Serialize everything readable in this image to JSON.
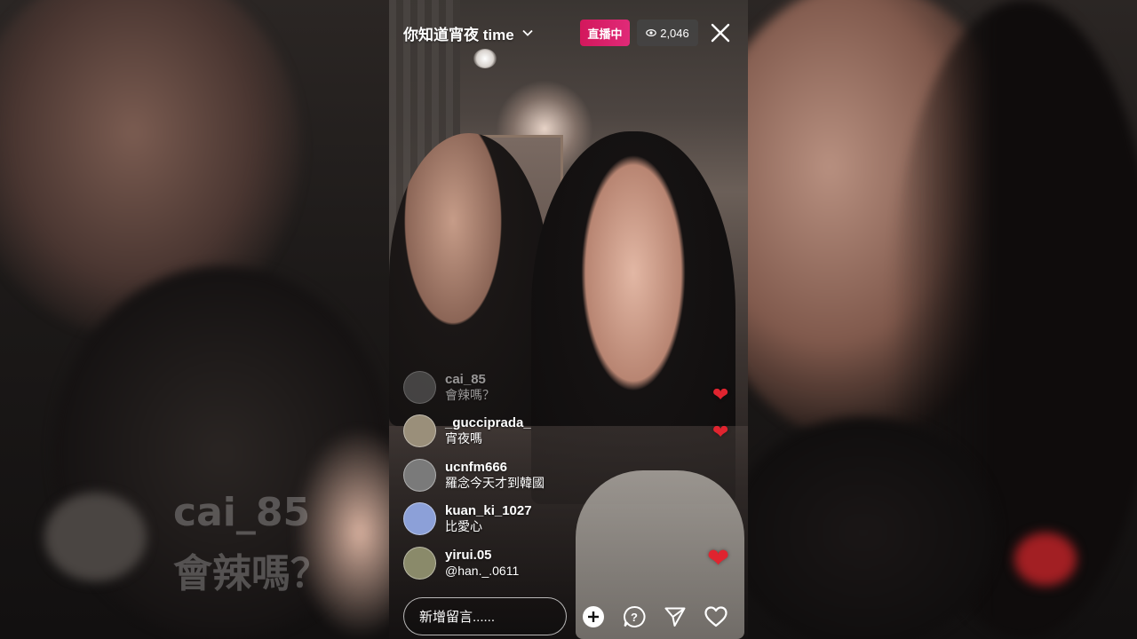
{
  "stream": {
    "title": "你知道宵夜 time",
    "live_label": "直播中",
    "viewer_count": "2,046"
  },
  "comments": [
    {
      "username": "cai_85",
      "message": "會辣嗎？",
      "avatar_color": "#6b6b6b"
    },
    {
      "username": "_gucciprada_",
      "message": "宵夜嗎",
      "avatar_color": "#9a8f7a"
    },
    {
      "username": "ucnfm666",
      "message": "羅念今天才到韓國",
      "avatar_color": "#7a7a7a"
    },
    {
      "username": "kuan_ki_1027",
      "message": "比愛心",
      "avatar_color": "#8ca0d8"
    },
    {
      "username": "yirui.05",
      "message": "@han._.0611",
      "avatar_color": "#8a8a6a"
    }
  ],
  "input": {
    "placeholder": "新增留言......"
  },
  "background_ghost": {
    "username": "cai_85",
    "message": "會辣嗎？"
  },
  "colors": {
    "live_badge": "#d3185c",
    "heart": "#e0242f"
  },
  "icons": {
    "add": "plus-circle-icon",
    "question": "question-bubble-icon",
    "share": "send-icon",
    "like": "heart-icon",
    "close": "close-icon"
  }
}
